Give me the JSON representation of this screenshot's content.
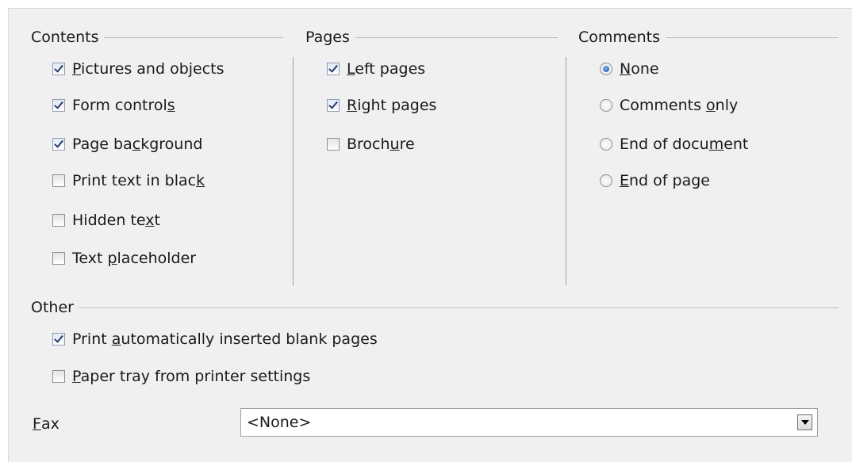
{
  "contents": {
    "title": "Contents",
    "options": [
      {
        "pre": "",
        "u": "P",
        "post": "ictures and objects",
        "checked": true
      },
      {
        "pre": "Form control",
        "u": "s",
        "post": "",
        "checked": true
      },
      {
        "pre": "Page ba",
        "u": "c",
        "post": "kground",
        "checked": true
      },
      {
        "pre": "Print text in blac",
        "u": "k",
        "post": "",
        "checked": false
      },
      {
        "pre": "Hidden te",
        "u": "x",
        "post": "t",
        "checked": false
      },
      {
        "pre": "Text ",
        "u": "p",
        "post": "laceholder",
        "checked": false
      }
    ]
  },
  "pages": {
    "title": "Pages",
    "options": [
      {
        "pre": "",
        "u": "L",
        "post": "eft pages",
        "checked": true
      },
      {
        "pre": "",
        "u": "R",
        "post": "ight pages",
        "checked": true
      },
      {
        "pre": "Broch",
        "u": "u",
        "post": "re",
        "checked": false
      }
    ]
  },
  "comments": {
    "title": "Comments",
    "options": [
      {
        "pre": "",
        "u": "N",
        "post": "one",
        "selected": true
      },
      {
        "pre": "Comments ",
        "u": "o",
        "post": "nly",
        "selected": false
      },
      {
        "pre": "End of docu",
        "u": "m",
        "post": "ent",
        "selected": false
      },
      {
        "pre": "",
        "u": "E",
        "post": "nd of page",
        "selected": false
      }
    ]
  },
  "other": {
    "title": "Other",
    "options": [
      {
        "pre": "Print ",
        "u": "a",
        "post": "utomatically inserted blank pages",
        "checked": true
      },
      {
        "pre": "",
        "u": "P",
        "post": "aper tray from printer settings",
        "checked": false
      }
    ],
    "fax": {
      "label_pre": "",
      "label_u": "F",
      "label_post": "ax",
      "value": "<None>"
    }
  },
  "colors": {
    "dialog_bg": "#f0f0f0",
    "check_mark": "#2a3a6a",
    "radio_dot": "#1c54a8"
  }
}
